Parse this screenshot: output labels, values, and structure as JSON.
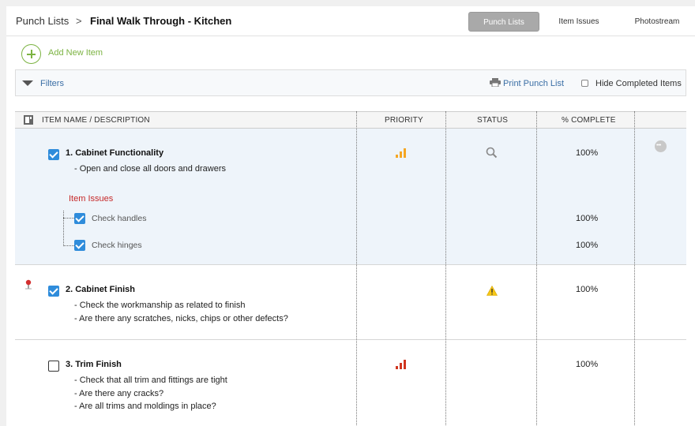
{
  "breadcrumb": {
    "root": "Punch Lists",
    "separator": ">",
    "current": "Final Walk Through - Kitchen"
  },
  "tabs": [
    {
      "label": "Punch Lists",
      "active": true
    },
    {
      "label": "Item Issues",
      "active": false
    },
    {
      "label": "Photostream",
      "active": false
    }
  ],
  "add_item": {
    "label": "Add New Item",
    "icon": "plus-circle-icon"
  },
  "filters": {
    "label": "Filters",
    "print_label": "Print Punch List",
    "hide_completed_label": "Hide Completed Items",
    "hide_completed_checked": false
  },
  "table": {
    "columns": [
      "ITEM NAME / DESCRIPTION",
      "PRIORITY",
      "STATUS",
      "% COMPLETE"
    ],
    "rows": [
      {
        "title": "1. Cabinet Functionality",
        "checked": true,
        "description": [
          "- Open and close all doors and drawers"
        ],
        "priority": "medium",
        "priority_color": "#f5a623",
        "status_icon": "search-icon",
        "percent": "100%",
        "issues_heading": "Item Issues",
        "issues": [
          {
            "label": "Check handles",
            "checked": true,
            "percent": "100%"
          },
          {
            "label": "Check hinges",
            "checked": true,
            "percent": "100%"
          }
        ]
      },
      {
        "title": "2. Cabinet Finish",
        "checked": true,
        "has_pin": true,
        "description": [
          "- Check the workmanship as related to finish",
          "- Are there any scratches, nicks, chips or other defects?"
        ],
        "status_icon": "warning-icon",
        "percent": "100%"
      },
      {
        "title": "3. Trim Finish",
        "checked": false,
        "description": [
          "- Check that all trim and fittings are tight",
          "- Are there any cracks?",
          "- Are all trims and moldings in place?"
        ],
        "priority": "high",
        "priority_color": "#d0351f",
        "percent": "100%"
      }
    ]
  }
}
